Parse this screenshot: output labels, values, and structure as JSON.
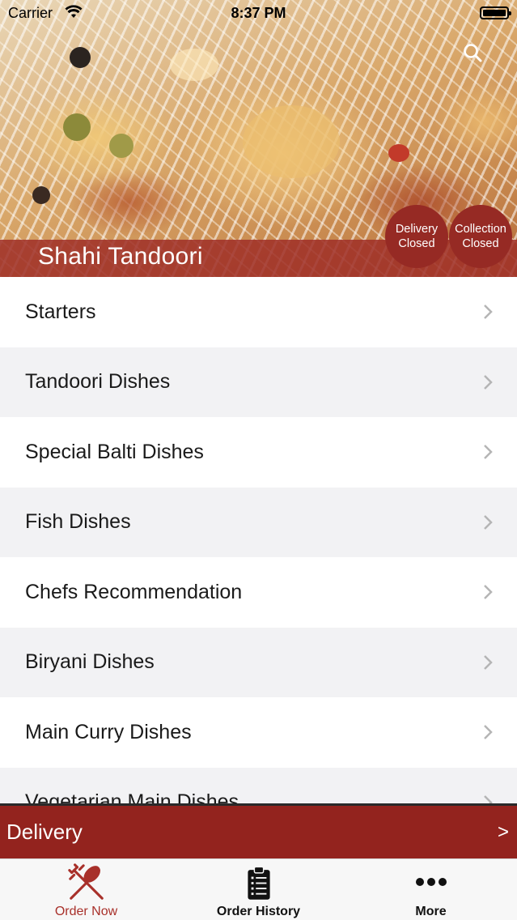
{
  "status_bar": {
    "carrier": "Carrier",
    "time": "8:37 PM"
  },
  "header": {
    "restaurant_name": "Shahi Tandoori",
    "delivery_status": {
      "line1": "Delivery",
      "line2": "Closed"
    },
    "collection_status": {
      "line1": "Collection",
      "line2": "Closed"
    },
    "search_icon": "search-icon"
  },
  "menu": {
    "items": [
      {
        "label": "Starters"
      },
      {
        "label": "Tandoori Dishes"
      },
      {
        "label": "Special Balti Dishes"
      },
      {
        "label": "Fish Dishes"
      },
      {
        "label": "Chefs Recommendation"
      },
      {
        "label": "Biryani Dishes"
      },
      {
        "label": "Main Curry Dishes"
      },
      {
        "label": "Vegetarian Main Dishes"
      }
    ]
  },
  "order_type_bar": {
    "label": "Delivery",
    "arrow": ">"
  },
  "tabbar": {
    "tabs": [
      {
        "label": "Order Now",
        "icon": "fork-knife-icon"
      },
      {
        "label": "Order History",
        "icon": "clipboard-icon"
      },
      {
        "label": "More",
        "icon": "ellipsis-icon"
      }
    ]
  },
  "colors": {
    "brand_red": "#93231e",
    "status_circle": "#962a24",
    "active_tab": "#a8302a"
  }
}
